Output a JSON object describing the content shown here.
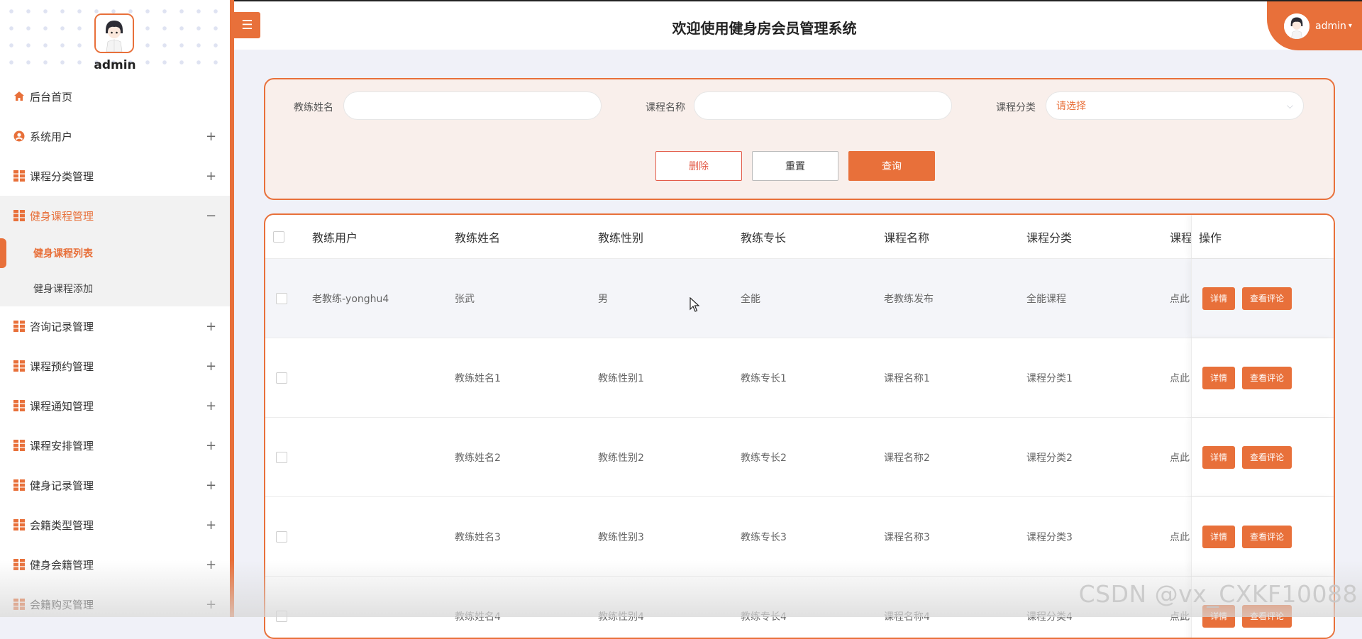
{
  "colors": {
    "accent": "#e8703a",
    "delete": "#e35c4a",
    "sidebar_bg": "#ffffff",
    "page_bg": "#f0f1f8"
  },
  "header": {
    "title": "欢迎使用健身房会员管理系统",
    "user": "admin",
    "toggle_icon": "hamburger-icon"
  },
  "sidebar": {
    "user": "admin",
    "items": [
      {
        "label": "后台首页",
        "icon": "home-icon",
        "toggle": ""
      },
      {
        "label": "系统用户",
        "icon": "user-icon",
        "toggle": "+"
      },
      {
        "label": "课程分类管理",
        "icon": "grid-icon",
        "toggle": "+"
      },
      {
        "label": "健身课程管理",
        "icon": "grid-icon",
        "toggle": "−",
        "expanded": true,
        "children": [
          {
            "label": "健身课程列表",
            "active": true
          },
          {
            "label": "健身课程添加"
          }
        ]
      },
      {
        "label": "咨询记录管理",
        "icon": "grid-icon",
        "toggle": "+"
      },
      {
        "label": "课程预约管理",
        "icon": "grid-icon",
        "toggle": "+"
      },
      {
        "label": "课程通知管理",
        "icon": "grid-icon",
        "toggle": "+"
      },
      {
        "label": "课程安排管理",
        "icon": "grid-icon",
        "toggle": "+"
      },
      {
        "label": "健身记录管理",
        "icon": "grid-icon",
        "toggle": "+"
      },
      {
        "label": "会籍类型管理",
        "icon": "grid-icon",
        "toggle": "+"
      },
      {
        "label": "健身会籍管理",
        "icon": "grid-icon",
        "toggle": "+"
      },
      {
        "label": "会籍购买管理",
        "icon": "grid-icon",
        "toggle": "+"
      }
    ]
  },
  "search": {
    "coach_name_label": "教练姓名",
    "coach_name_value": "",
    "course_name_label": "课程名称",
    "course_name_value": "",
    "category_label": "课程分类",
    "category_placeholder": "请选择",
    "delete_label": "删除",
    "reset_label": "重置",
    "query_label": "查询"
  },
  "table": {
    "columns": [
      "教练用户",
      "教练姓名",
      "教练性别",
      "教练专长",
      "课程名称",
      "课程分类",
      "课程",
      "操作"
    ],
    "rows": [
      {
        "user": "老教练-yonghu4",
        "name": "张武",
        "gender": "男",
        "specialty": "全能",
        "course": "老教练发布",
        "category": "全能课程",
        "clicks": "点此"
      },
      {
        "user": "",
        "name": "教练姓名1",
        "gender": "教练性别1",
        "specialty": "教练专长1",
        "course": "课程名称1",
        "category": "课程分类1",
        "clicks": "点此"
      },
      {
        "user": "",
        "name": "教练姓名2",
        "gender": "教练性别2",
        "specialty": "教练专长2",
        "course": "课程名称2",
        "category": "课程分类2",
        "clicks": "点此"
      },
      {
        "user": "",
        "name": "教练姓名3",
        "gender": "教练性别3",
        "specialty": "教练专长3",
        "course": "课程名称3",
        "category": "课程分类3",
        "clicks": "点此"
      },
      {
        "user": "",
        "name": "教练姓名4",
        "gender": "教练性别4",
        "specialty": "教练专长4",
        "course": "课程名称4",
        "category": "课程分类4",
        "clicks": "点此"
      }
    ],
    "detail_label": "详情",
    "comment_label": "查看评论"
  },
  "watermark": "CSDN @vx_CXKF10088"
}
